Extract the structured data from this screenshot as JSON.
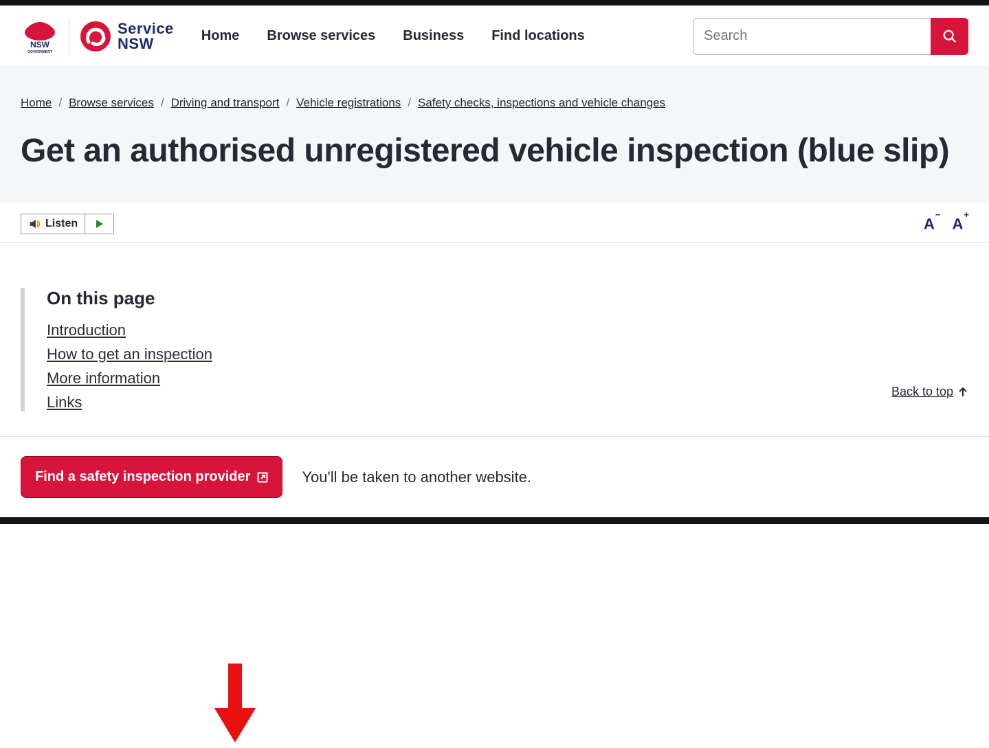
{
  "header": {
    "logo_nsw_text": "NSW GOVERNMENT",
    "logo_service_text_1": "Service",
    "logo_service_text_2": "NSW",
    "nav": {
      "home": "Home",
      "browse": "Browse services",
      "business": "Business",
      "locations": "Find locations"
    },
    "search_placeholder": "Search"
  },
  "breadcrumb": {
    "items": [
      {
        "label": "Home"
      },
      {
        "label": "Browse services"
      },
      {
        "label": "Driving and transport"
      },
      {
        "label": "Vehicle registrations"
      },
      {
        "label": "Safety checks, inspections and vehicle changes"
      }
    ],
    "separator": "/"
  },
  "page_title": "Get an authorised unregistered vehicle inspection (blue slip)",
  "util": {
    "listen_label": "Listen",
    "decrease": "A",
    "decrease_sup": "−",
    "increase": "A",
    "increase_sup": "+"
  },
  "on_this_page": {
    "heading": "On this page",
    "links": [
      "Introduction",
      "How to get an inspection",
      "More information",
      "Links"
    ]
  },
  "back_to_top": "Back to top",
  "cta": {
    "button_label": "Find a safety inspection provider",
    "note": "You'll be taken to another website."
  }
}
